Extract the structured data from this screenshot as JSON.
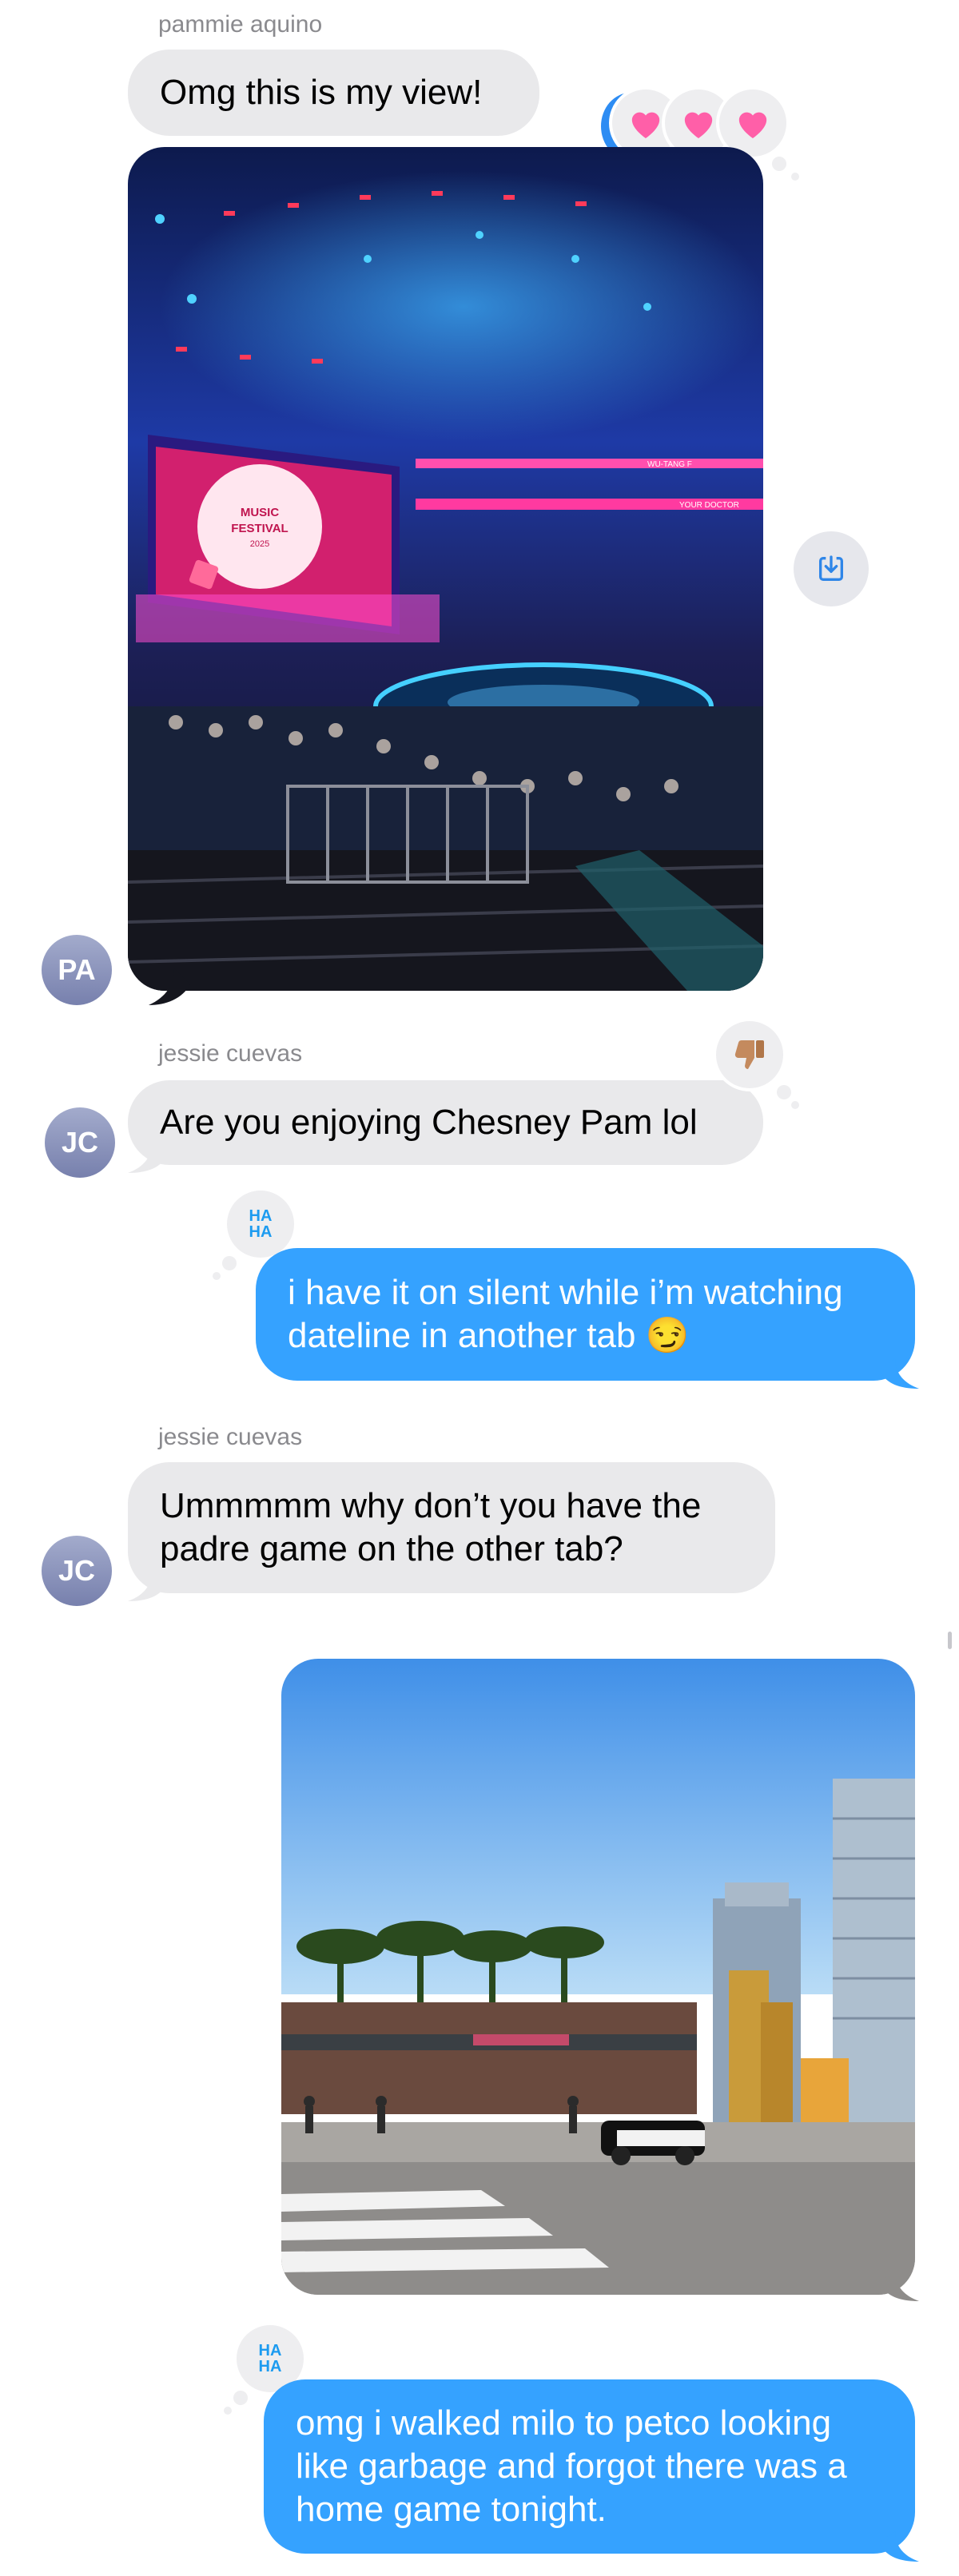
{
  "messages": [
    {
      "sender": "pammie aquino",
      "text": "Omg this is my view!",
      "avatar": "PA"
    },
    {
      "sender": "jessie cuevas",
      "text": "Are you enjoying Chesney Pam lol",
      "avatar": "JC"
    },
    {
      "text_line1": "i have it on silent while i’m watching",
      "text_line2": "dateline in another tab 😏"
    },
    {
      "sender": "jessie cuevas",
      "text_line1": "Ummmmm why don’t you have the",
      "text_line2": "padre game on the other tab?",
      "avatar": "JC"
    },
    {
      "text_line1": "omg i walked milo to petco looking",
      "text_line2": "like garbage and forgot there was a",
      "text_line3": "home game tonight."
    }
  ],
  "tapbacks": {
    "hearts": [
      "heart-icon",
      "heart-icon",
      "heart-icon"
    ],
    "haha_label_1": "HA",
    "haha_label_2": "HA",
    "thumbs_down": "thumbs-down-icon"
  },
  "photos": {
    "concert": {
      "screen_line1": "MUSIC",
      "screen_line2": "FESTIVAL",
      "screen_line3": "2025",
      "banner": "WU-TANG F",
      "banner2": "YOUR DOCTOR"
    },
    "street": {}
  },
  "colors": {
    "incoming": "#e9e9eb",
    "outgoing": "#35a2ff",
    "heart": "#ff5fa8"
  }
}
